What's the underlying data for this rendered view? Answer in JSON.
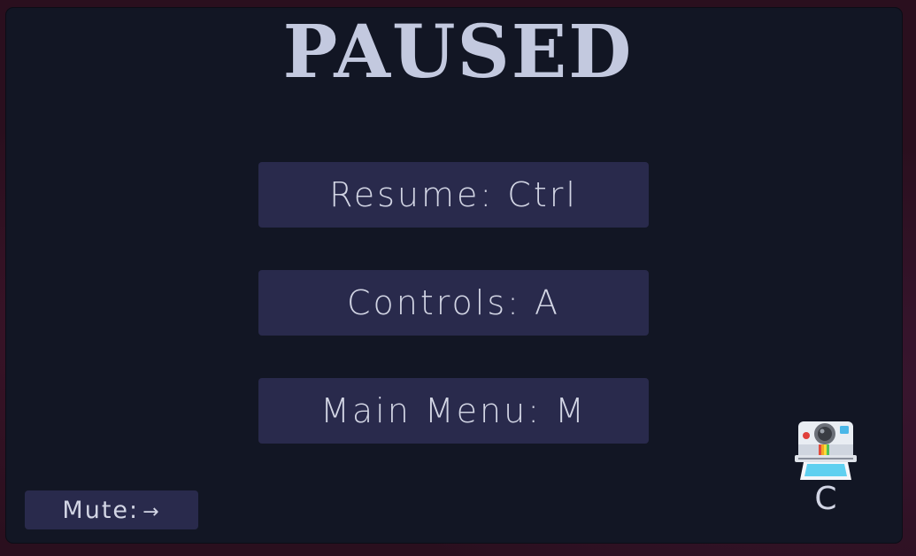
{
  "title": "PAUSED",
  "menu": {
    "resume_label": "Resume: Ctrl",
    "controls_label": "Controls: A",
    "main_menu_label": "Main Menu: M"
  },
  "mute": {
    "label": "Mute:",
    "key_glyph": "→"
  },
  "camera": {
    "icon": "instant-camera-icon",
    "key_label": "C"
  },
  "colors": {
    "panel": "#121624",
    "button": "#292a4c",
    "title": "#c3c9df",
    "text": "#d2d5e4"
  }
}
